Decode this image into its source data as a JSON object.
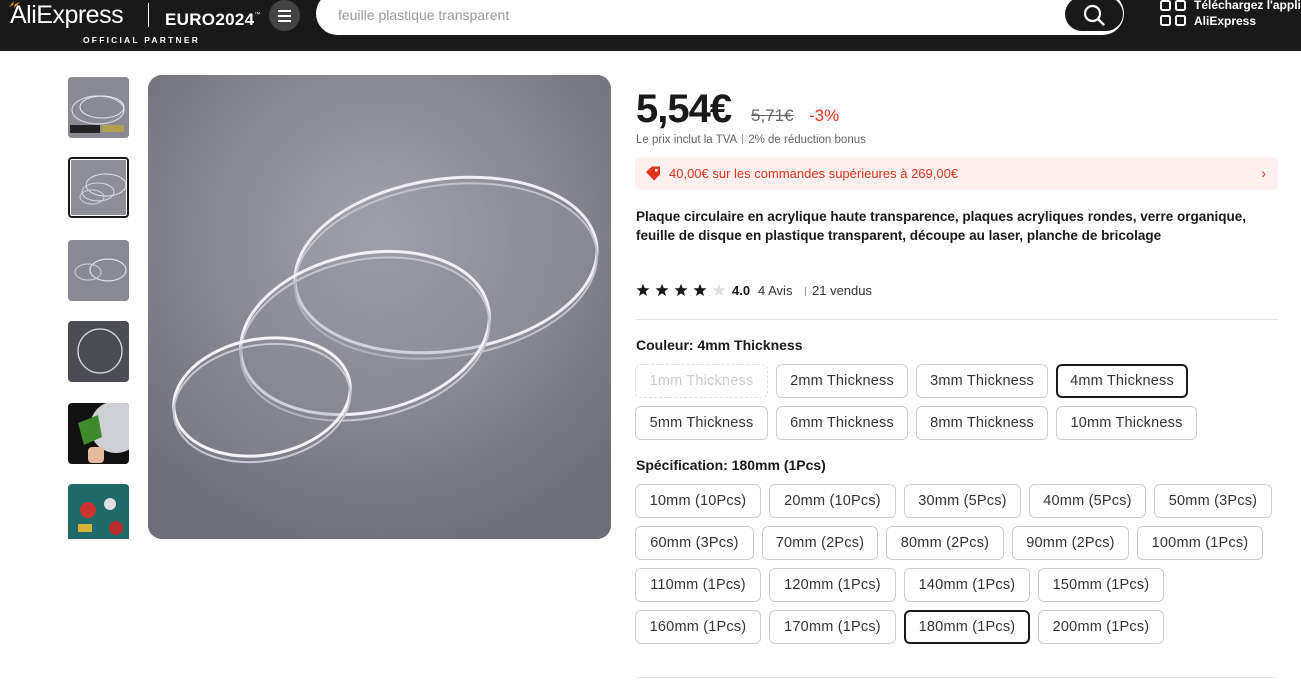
{
  "header": {
    "logo": "AliExpress",
    "partner_label": "OFFICIAL PARTNER",
    "euro_label": "EURO2024",
    "euro_mark": "™",
    "search_placeholder": "feuille plastique transparent",
    "download_line1": "Téléchargez l'applica",
    "download_line2": "AliExpress"
  },
  "product": {
    "price": "5,54€",
    "old_price": "5,71€",
    "discount": "-3%",
    "tva_note": "Le prix inclut la TVA",
    "bonus_note": "2% de réduction bonus",
    "promo": "40,00€ sur les commandes supérieures à 269,00€",
    "title": "Plaque circulaire en acrylique haute transparence, plaques acryliques rondes, verre organique, feuille de disque en plastique transparent, découpe au laser, planche de bricolage",
    "rating_value": 4,
    "rating_max": 5,
    "rating_score": "4.0",
    "reviews": "4 Avis",
    "sold": "21 vendus"
  },
  "color": {
    "label": "Couleur: 4mm Thickness",
    "options": [
      "1mm Thickness",
      "2mm Thickness",
      "3mm Thickness",
      "4mm Thickness",
      "5mm Thickness",
      "6mm Thickness",
      "8mm Thickness",
      "10mm Thickness"
    ],
    "selected": "4mm Thickness",
    "disabled": [
      "1mm Thickness"
    ]
  },
  "spec": {
    "label": "Spécification: 180mm (1Pcs)",
    "options": [
      "10mm (10Pcs)",
      "20mm (10Pcs)",
      "30mm (5Pcs)",
      "40mm (5Pcs)",
      "50mm (3Pcs)",
      "60mm (3Pcs)",
      "70mm (2Pcs)",
      "80mm (2Pcs)",
      "90mm (2Pcs)",
      "100mm (1Pcs)",
      "110mm (1Pcs)",
      "120mm (1Pcs)",
      "140mm (1Pcs)",
      "150mm (1Pcs)",
      "160mm (1Pcs)",
      "170mm (1Pcs)",
      "180mm (1Pcs)",
      "200mm (1Pcs)"
    ],
    "selected": "180mm (1Pcs)"
  },
  "icons": [
    "menu-icon",
    "search-icon",
    "qr-code-icon",
    "coupon-tag-icon",
    "chevron-right-icon",
    "star-icon"
  ],
  "colors": {
    "header_bg": "#191919",
    "promo_bg": "#fff0f0",
    "accent_red": "#e4341c",
    "logo_flash": "#f7a01f"
  }
}
